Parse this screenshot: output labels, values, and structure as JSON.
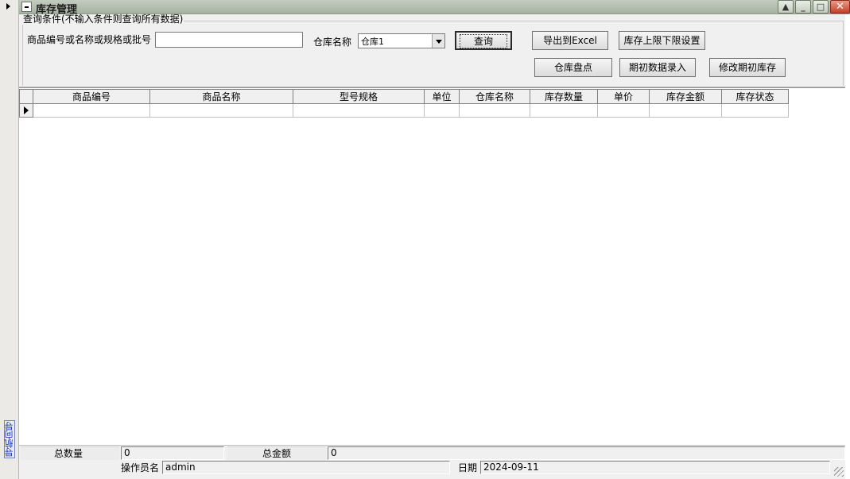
{
  "window": {
    "title": "库存管理"
  },
  "left_strip": {
    "nav_label": "导航向导"
  },
  "query": {
    "caption": "查询条件(不输入条件则查询所有数据)",
    "keyword_label": "商品编号或名称或规格或批号",
    "keyword_value": "",
    "warehouse_label": "仓库名称",
    "warehouse_value": "仓库1"
  },
  "buttons": {
    "query": "查询",
    "export": "导出到Excel",
    "limit_setting": "库存上限下限设置",
    "stocktake": "仓库盘点",
    "initial_entry": "期初数据录入",
    "edit_initial": "修改期初库存"
  },
  "grid": {
    "columns": [
      "商品编号",
      "商品名称",
      "型号规格",
      "单位",
      "仓库名称",
      "库存数量",
      "单价",
      "库存金额",
      "库存状态"
    ],
    "rows": []
  },
  "summary": {
    "total_qty_label": "总数量",
    "total_qty_value": "0",
    "total_amount_label": "总金额",
    "total_amount_value": "0",
    "operator_label": "操作员名",
    "operator_value": "admin",
    "date_label": "日期",
    "date_value": "2024-09-11"
  }
}
